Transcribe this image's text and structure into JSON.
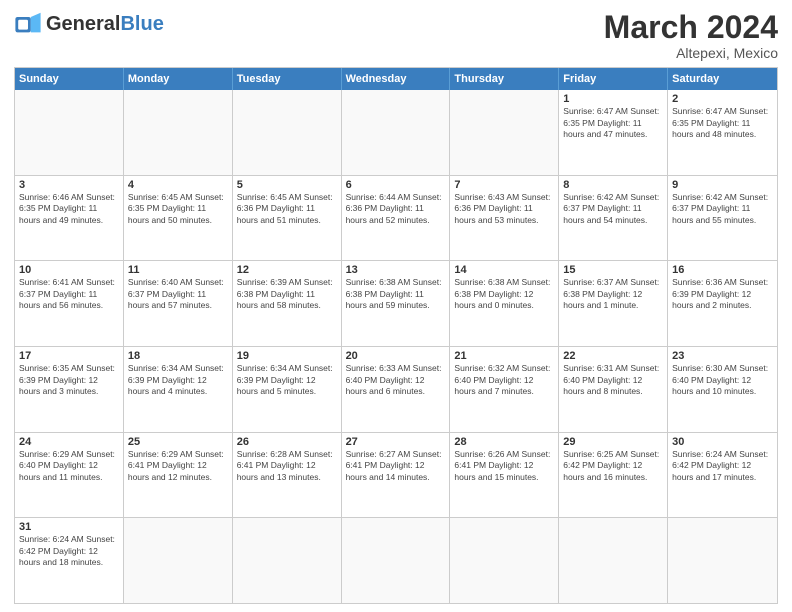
{
  "logo": {
    "text_general": "General",
    "text_blue": "Blue"
  },
  "title": "March 2024",
  "subtitle": "Altepexi, Mexico",
  "header_days": [
    "Sunday",
    "Monday",
    "Tuesday",
    "Wednesday",
    "Thursday",
    "Friday",
    "Saturday"
  ],
  "rows": [
    [
      {
        "day": "",
        "info": ""
      },
      {
        "day": "",
        "info": ""
      },
      {
        "day": "",
        "info": ""
      },
      {
        "day": "",
        "info": ""
      },
      {
        "day": "",
        "info": ""
      },
      {
        "day": "1",
        "info": "Sunrise: 6:47 AM\nSunset: 6:35 PM\nDaylight: 11 hours\nand 47 minutes."
      },
      {
        "day": "2",
        "info": "Sunrise: 6:47 AM\nSunset: 6:35 PM\nDaylight: 11 hours\nand 48 minutes."
      }
    ],
    [
      {
        "day": "3",
        "info": "Sunrise: 6:46 AM\nSunset: 6:35 PM\nDaylight: 11 hours\nand 49 minutes."
      },
      {
        "day": "4",
        "info": "Sunrise: 6:45 AM\nSunset: 6:35 PM\nDaylight: 11 hours\nand 50 minutes."
      },
      {
        "day": "5",
        "info": "Sunrise: 6:45 AM\nSunset: 6:36 PM\nDaylight: 11 hours\nand 51 minutes."
      },
      {
        "day": "6",
        "info": "Sunrise: 6:44 AM\nSunset: 6:36 PM\nDaylight: 11 hours\nand 52 minutes."
      },
      {
        "day": "7",
        "info": "Sunrise: 6:43 AM\nSunset: 6:36 PM\nDaylight: 11 hours\nand 53 minutes."
      },
      {
        "day": "8",
        "info": "Sunrise: 6:42 AM\nSunset: 6:37 PM\nDaylight: 11 hours\nand 54 minutes."
      },
      {
        "day": "9",
        "info": "Sunrise: 6:42 AM\nSunset: 6:37 PM\nDaylight: 11 hours\nand 55 minutes."
      }
    ],
    [
      {
        "day": "10",
        "info": "Sunrise: 6:41 AM\nSunset: 6:37 PM\nDaylight: 11 hours\nand 56 minutes."
      },
      {
        "day": "11",
        "info": "Sunrise: 6:40 AM\nSunset: 6:37 PM\nDaylight: 11 hours\nand 57 minutes."
      },
      {
        "day": "12",
        "info": "Sunrise: 6:39 AM\nSunset: 6:38 PM\nDaylight: 11 hours\nand 58 minutes."
      },
      {
        "day": "13",
        "info": "Sunrise: 6:38 AM\nSunset: 6:38 PM\nDaylight: 11 hours\nand 59 minutes."
      },
      {
        "day": "14",
        "info": "Sunrise: 6:38 AM\nSunset: 6:38 PM\nDaylight: 12 hours\nand 0 minutes."
      },
      {
        "day": "15",
        "info": "Sunrise: 6:37 AM\nSunset: 6:38 PM\nDaylight: 12 hours\nand 1 minute."
      },
      {
        "day": "16",
        "info": "Sunrise: 6:36 AM\nSunset: 6:39 PM\nDaylight: 12 hours\nand 2 minutes."
      }
    ],
    [
      {
        "day": "17",
        "info": "Sunrise: 6:35 AM\nSunset: 6:39 PM\nDaylight: 12 hours\nand 3 minutes."
      },
      {
        "day": "18",
        "info": "Sunrise: 6:34 AM\nSunset: 6:39 PM\nDaylight: 12 hours\nand 4 minutes."
      },
      {
        "day": "19",
        "info": "Sunrise: 6:34 AM\nSunset: 6:39 PM\nDaylight: 12 hours\nand 5 minutes."
      },
      {
        "day": "20",
        "info": "Sunrise: 6:33 AM\nSunset: 6:40 PM\nDaylight: 12 hours\nand 6 minutes."
      },
      {
        "day": "21",
        "info": "Sunrise: 6:32 AM\nSunset: 6:40 PM\nDaylight: 12 hours\nand 7 minutes."
      },
      {
        "day": "22",
        "info": "Sunrise: 6:31 AM\nSunset: 6:40 PM\nDaylight: 12 hours\nand 8 minutes."
      },
      {
        "day": "23",
        "info": "Sunrise: 6:30 AM\nSunset: 6:40 PM\nDaylight: 12 hours\nand 10 minutes."
      }
    ],
    [
      {
        "day": "24",
        "info": "Sunrise: 6:29 AM\nSunset: 6:40 PM\nDaylight: 12 hours\nand 11 minutes."
      },
      {
        "day": "25",
        "info": "Sunrise: 6:29 AM\nSunset: 6:41 PM\nDaylight: 12 hours\nand 12 minutes."
      },
      {
        "day": "26",
        "info": "Sunrise: 6:28 AM\nSunset: 6:41 PM\nDaylight: 12 hours\nand 13 minutes."
      },
      {
        "day": "27",
        "info": "Sunrise: 6:27 AM\nSunset: 6:41 PM\nDaylight: 12 hours\nand 14 minutes."
      },
      {
        "day": "28",
        "info": "Sunrise: 6:26 AM\nSunset: 6:41 PM\nDaylight: 12 hours\nand 15 minutes."
      },
      {
        "day": "29",
        "info": "Sunrise: 6:25 AM\nSunset: 6:42 PM\nDaylight: 12 hours\nand 16 minutes."
      },
      {
        "day": "30",
        "info": "Sunrise: 6:24 AM\nSunset: 6:42 PM\nDaylight: 12 hours\nand 17 minutes."
      }
    ],
    [
      {
        "day": "31",
        "info": "Sunrise: 6:24 AM\nSunset: 6:42 PM\nDaylight: 12 hours\nand 18 minutes."
      },
      {
        "day": "",
        "info": ""
      },
      {
        "day": "",
        "info": ""
      },
      {
        "day": "",
        "info": ""
      },
      {
        "day": "",
        "info": ""
      },
      {
        "day": "",
        "info": ""
      },
      {
        "day": "",
        "info": ""
      }
    ]
  ]
}
